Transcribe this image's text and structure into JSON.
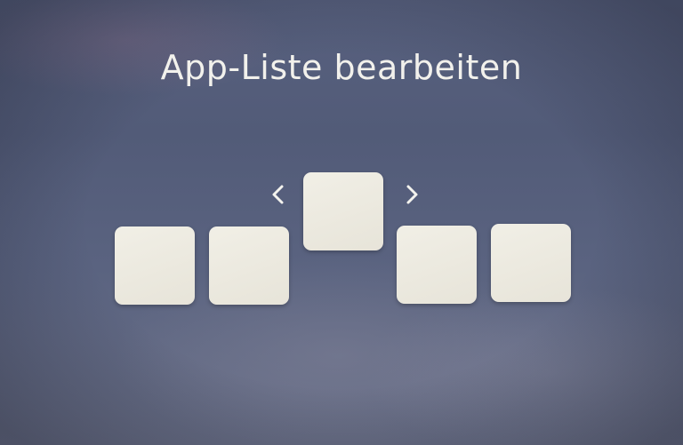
{
  "header": {
    "title": "App-Liste bearbeiten"
  },
  "icons": {
    "move_left": "chevron-left-icon",
    "move_right": "chevron-right-icon"
  },
  "colors": {
    "background": "#555e7b",
    "tile": "#efede4",
    "text": "#f2f1ec"
  },
  "app_list": {
    "selected_index": 2,
    "tile_count": 5
  }
}
